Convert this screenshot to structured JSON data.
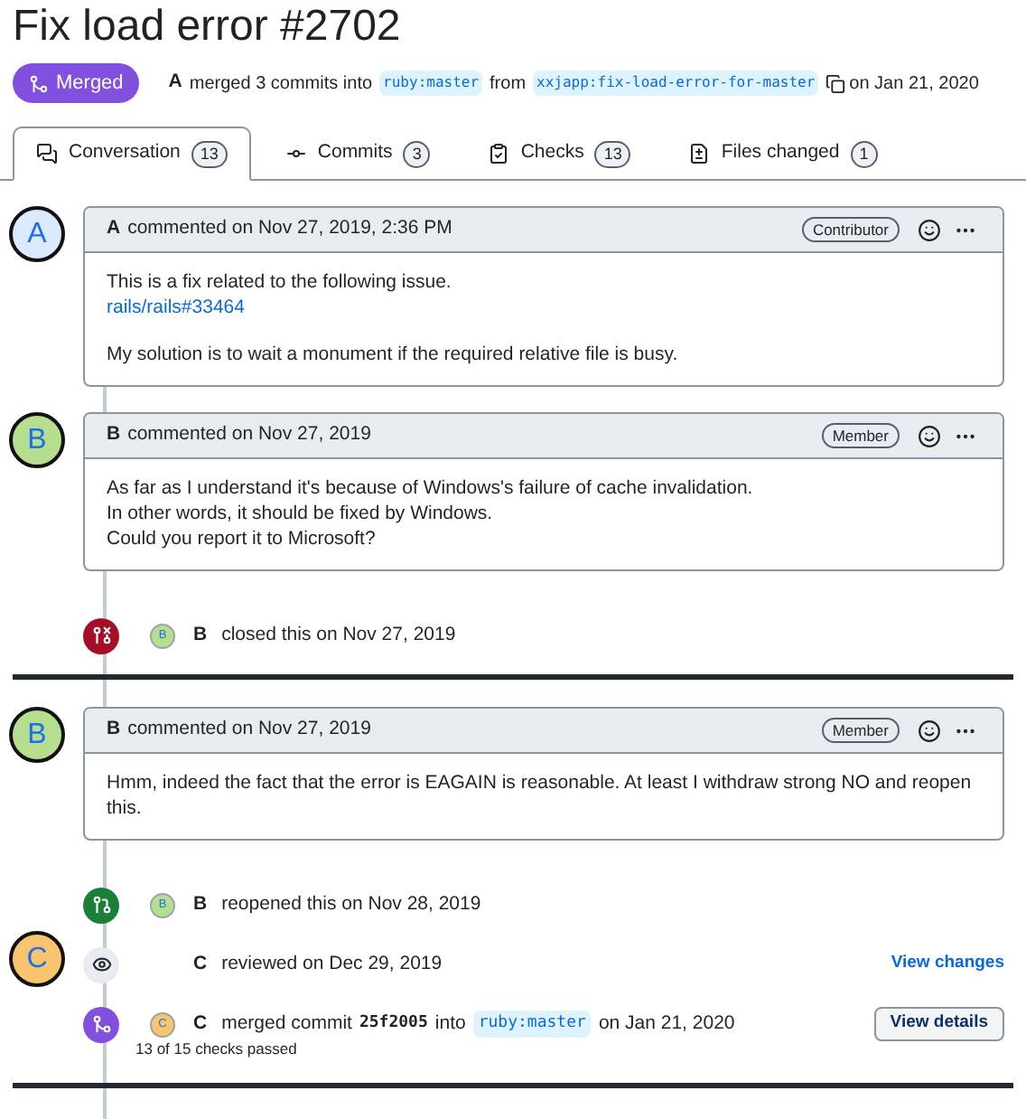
{
  "title": "Fix load error #2702",
  "status": {
    "label": "Merged"
  },
  "summary": {
    "author": "A",
    "parts": [
      {
        "kind": "text",
        "text": "merged 3 commits into"
      },
      {
        "kind": "branch",
        "text": "ruby:master"
      },
      {
        "kind": "text",
        "text": "from"
      },
      {
        "kind": "branch",
        "text": "xxjapp:fix-load-error-for-master"
      },
      {
        "kind": "copy"
      },
      {
        "kind": "text",
        "text": "on Jan 21, 2020"
      }
    ]
  },
  "tabs": [
    {
      "label": "Conversation",
      "count": "13",
      "selected": true
    },
    {
      "label": "Commits",
      "count": "3",
      "selected": false
    },
    {
      "label": "Checks",
      "count": "13",
      "selected": false
    },
    {
      "label": "Files changed",
      "count": "1",
      "selected": false
    }
  ],
  "timeline": [
    {
      "kind": "comment",
      "avatar": {
        "letter": "A",
        "color": "#dbeafe"
      },
      "author": "A",
      "meta": "commented on Nov 27, 2019, 2:36 PM",
      "role": "Contributor",
      "paragraphs": [
        [
          {
            "text": "This is a fix related to the following issue.",
            "link": false
          },
          {
            "text": "rails/rails#33464",
            "link": true
          }
        ],
        [
          {
            "text": "My solution is to wait a monument if the required relative file is busy.",
            "link": false
          }
        ]
      ]
    },
    {
      "kind": "comment",
      "avatar": {
        "letter": "B",
        "color": "#b5de8f"
      },
      "author": "B",
      "meta": "commented on Nov 27, 2019",
      "role": "Member",
      "paragraphs": [
        [
          {
            "text": "As far as I understand it's because of Windows's failure of cache invalidation.",
            "link": false
          },
          {
            "text": "In other words, it should be fixed by Windows.",
            "link": false
          },
          {
            "text": "Could you report it to Microsoft?",
            "link": false
          }
        ]
      ]
    },
    {
      "kind": "closed",
      "avatar": {
        "letter": "B",
        "color": "#b5de8f"
      },
      "author": "B",
      "parts": [
        {
          "kind": "text",
          "text": "closed this on Nov 27, 2019"
        }
      ]
    },
    {
      "kind": "divider"
    },
    {
      "kind": "comment",
      "avatar": {
        "letter": "B",
        "color": "#b5de8f"
      },
      "author": "B",
      "meta": "commented on Nov 27, 2019",
      "role": "Member",
      "paragraphs": [
        [
          {
            "text": "Hmm, indeed the fact that the error is EAGAIN is reasonable. At least I withdraw strong NO and reopen this.",
            "link": false
          }
        ]
      ]
    },
    {
      "kind": "reopened",
      "avatar": {
        "letter": "B",
        "color": "#b5de8f"
      },
      "author": "B",
      "parts": [
        {
          "kind": "text",
          "text": "reopened this on Nov 28, 2019"
        }
      ]
    },
    {
      "kind": "reviewed",
      "big_avatar": {
        "letter": "C",
        "color": "#f9c46e"
      },
      "author": "C",
      "parts": [
        {
          "kind": "text",
          "text": "reviewed on Dec 29, 2019"
        }
      ],
      "link": "View changes"
    },
    {
      "kind": "merged",
      "avatar": {
        "letter": "C",
        "color": "#f9c46e"
      },
      "author": "C",
      "parts": [
        {
          "kind": "text",
          "text": "merged commit"
        },
        {
          "kind": "sha",
          "text": "25f2005"
        },
        {
          "kind": "text",
          "text": "into"
        },
        {
          "kind": "branch",
          "text": "ruby:master"
        },
        {
          "kind": "text",
          "text": "on Jan 21, 2020"
        }
      ],
      "note": "13 of 15 checks passed",
      "button": "View details"
    },
    {
      "kind": "divider"
    }
  ]
}
